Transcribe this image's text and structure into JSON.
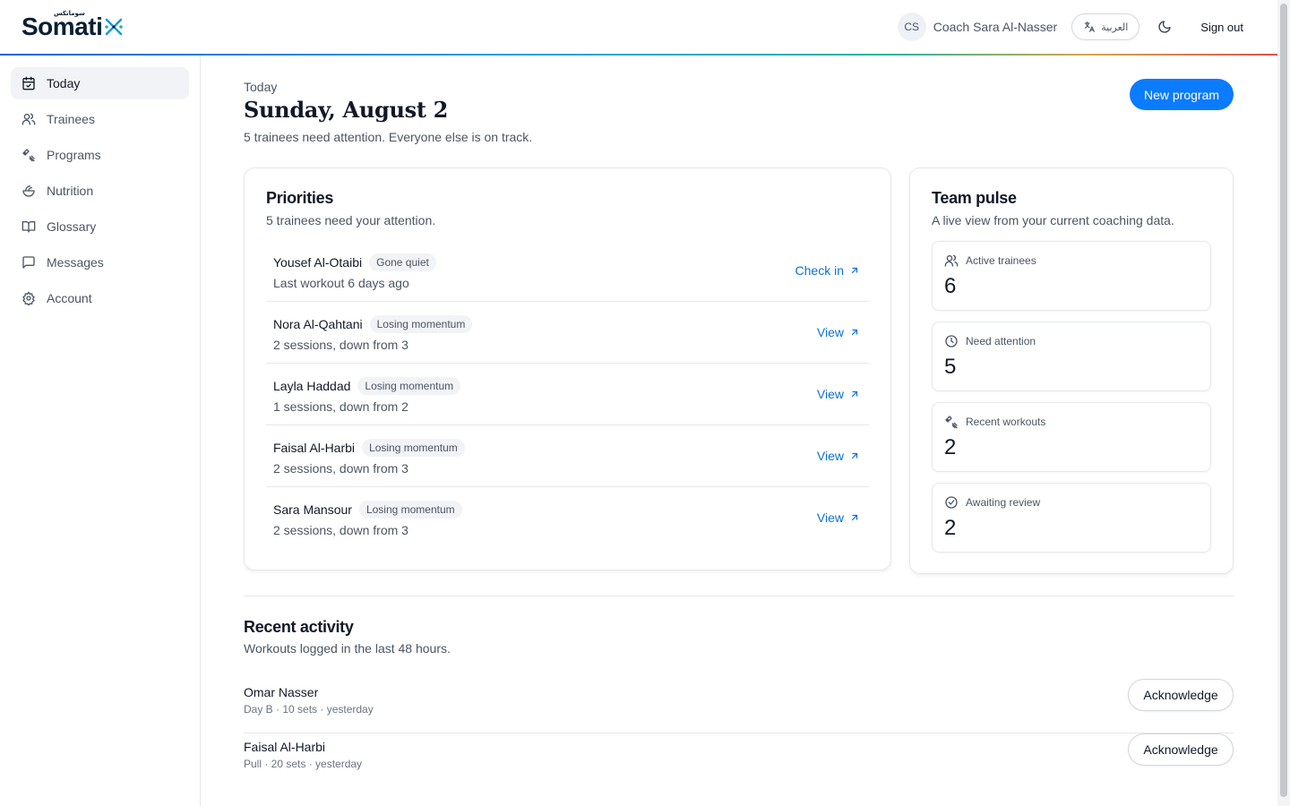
{
  "header": {
    "logo_text": "Somati",
    "logo_arabic": "سوماتكس",
    "avatar_initials": "CS",
    "coach_name": "Coach Sara Al-Nasser",
    "lang_label": "العربية",
    "signout_label": "Sign out"
  },
  "sidebar": {
    "items": [
      {
        "label": "Today",
        "icon": "calendar-check-icon",
        "active": true
      },
      {
        "label": "Trainees",
        "icon": "users-icon"
      },
      {
        "label": "Programs",
        "icon": "programs-icon"
      },
      {
        "label": "Nutrition",
        "icon": "nutrition-icon"
      },
      {
        "label": "Glossary",
        "icon": "book-open-icon"
      },
      {
        "label": "Messages",
        "icon": "message-square-icon"
      },
      {
        "label": "Account",
        "icon": "gear-icon"
      }
    ]
  },
  "main": {
    "overline": "Today",
    "title": "Sunday, August 2",
    "subtitle": "5 trainees need attention. Everyone else is on track.",
    "new_program_label": "New program"
  },
  "priorities": {
    "title": "Priorities",
    "subtitle": "5 trainees need your attention.",
    "rows": [
      {
        "name": "Yousef Al-Otaibi",
        "badge": "Gone quiet",
        "detail": "Last workout 6 days ago",
        "action": "Check in"
      },
      {
        "name": "Nora Al-Qahtani",
        "badge": "Losing momentum",
        "detail": "2 sessions, down from 3",
        "action": "View"
      },
      {
        "name": "Layla Haddad",
        "badge": "Losing momentum",
        "detail": "1 sessions, down from 2",
        "action": "View"
      },
      {
        "name": "Faisal Al-Harbi",
        "badge": "Losing momentum",
        "detail": "2 sessions, down from 3",
        "action": "View"
      },
      {
        "name": "Sara Mansour",
        "badge": "Losing momentum",
        "detail": "2 sessions, down from 3",
        "action": "View"
      }
    ]
  },
  "team_pulse": {
    "title": "Team pulse",
    "subtitle": "A live view from your current coaching data.",
    "stats": [
      {
        "label": "Active trainees",
        "value": "6",
        "icon": "users-icon"
      },
      {
        "label": "Need attention",
        "value": "5",
        "icon": "clock-icon"
      },
      {
        "label": "Recent workouts",
        "value": "2",
        "icon": "programs-icon"
      },
      {
        "label": "Awaiting review",
        "value": "2",
        "icon": "check-circle-icon"
      }
    ]
  },
  "recent_activity": {
    "title": "Recent activity",
    "subtitle": "Workouts logged in the last 48 hours.",
    "rows": [
      {
        "name": "Omar Nasser",
        "detail": "Day B · 10 sets · yesterday",
        "action": "Acknowledge"
      },
      {
        "name": "Faisal Al-Harbi",
        "detail": "Pull · 20 sets · yesterday",
        "action": "Acknowledge"
      }
    ]
  },
  "colors": {
    "accent": "#0b7bff",
    "link": "#0b6fd8"
  }
}
